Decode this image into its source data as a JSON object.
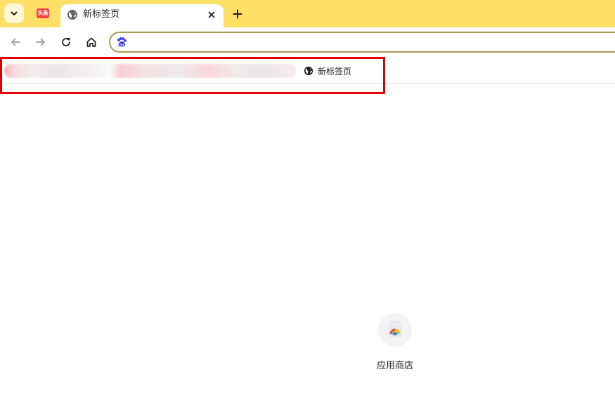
{
  "tabs": {
    "pinned_icon_text": "头条",
    "active_title": "新标签页"
  },
  "omnibox": {
    "value": "",
    "placeholder": ""
  },
  "bookmarks": {
    "items": [
      {
        "label": "新标签页",
        "icon": "globe-icon"
      }
    ]
  },
  "shortcuts": [
    {
      "label": "应用商店",
      "icon": "chrome-web-store-icon"
    }
  ],
  "colors": {
    "tab_strip": "#ffe066",
    "omnibox_border": "#a89a55",
    "highlight": "#e00000"
  }
}
